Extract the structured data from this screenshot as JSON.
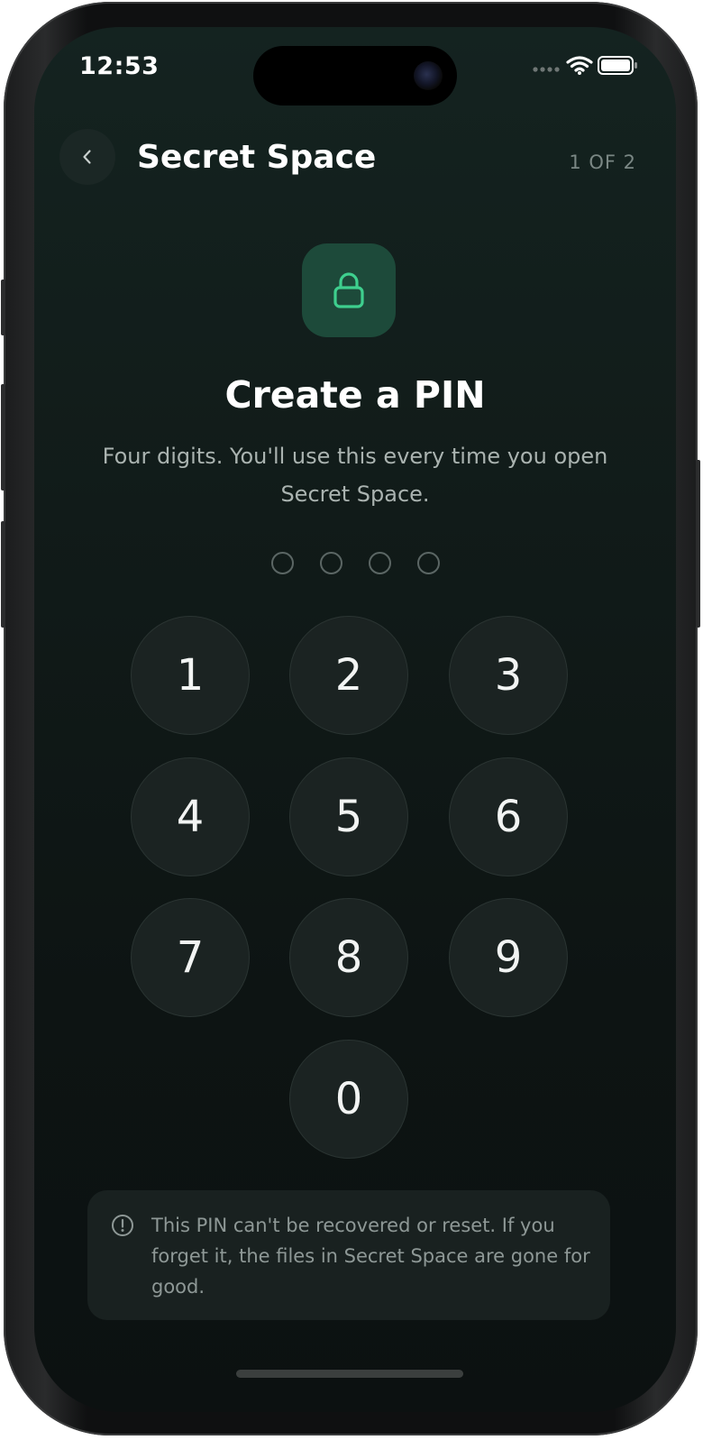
{
  "status_bar": {
    "time": "12:53",
    "icons": [
      "cellular-dots-icon",
      "wifi-icon",
      "battery-icon"
    ]
  },
  "nav": {
    "back_icon": "chevron-left-icon",
    "title": "Secret Space",
    "step": "1 OF 2"
  },
  "hero": {
    "icon": "lock-icon",
    "heading": "Create a PIN",
    "subtitle": "Four digits. You'll use this every time you open Secret Space."
  },
  "pin": {
    "length": 4,
    "filled": 0
  },
  "keypad": {
    "keys": [
      "1",
      "2",
      "3",
      "4",
      "5",
      "6",
      "7",
      "8",
      "9",
      "0"
    ]
  },
  "warning": {
    "icon": "alert-circle-icon",
    "text": "This PIN can't be recovered or reset. If you forget it, the files in Secret Space are gone for good."
  },
  "colors": {
    "accent": "#3ecf8e",
    "background": "#111b19",
    "key_fill": "#1b2322"
  }
}
